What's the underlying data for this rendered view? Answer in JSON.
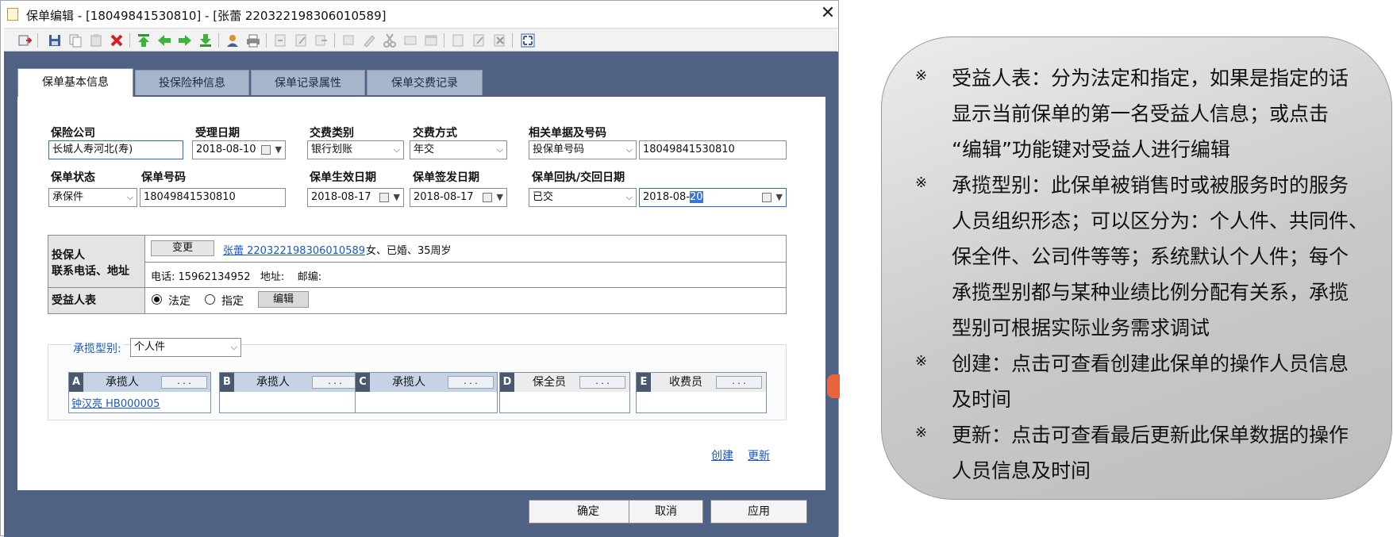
{
  "window": {
    "title": "保单编辑 - [18049841530810] - [张蕾 220322198306010589]",
    "close": "✕"
  },
  "toolbar": {
    "icons": [
      "exit-icon",
      "save-icon",
      "copy-icon",
      "paste-icon",
      "delete-icon",
      "first-icon",
      "prev-icon",
      "next-icon",
      "last-icon",
      "user-icon",
      "print-icon",
      "import-icon",
      "edit-icon",
      "export-icon",
      "review-icon",
      "pen-icon",
      "cut-icon",
      "approve-icon",
      "window-icon",
      "doc-icon",
      "modify-icon",
      "remove-icon",
      "fullscreen-icon"
    ]
  },
  "tabs": [
    "保单基本信息",
    "投保险种信息",
    "保单记录属性",
    "保单交费记录"
  ],
  "form": {
    "insurer_label": "保险公司",
    "insurer_value": "长城人寿河北(寿)",
    "accept_date_label": "受理日期",
    "accept_date_value": "2018-08-10",
    "pay_type_label": "交费类别",
    "pay_type_value": "银行划账",
    "pay_mode_label": "交费方式",
    "pay_mode_value": "年交",
    "related_doc_label": "相关单据及号码",
    "related_doc_type": "投保单号码",
    "related_doc_no": "18049841530810",
    "status_label": "保单状态",
    "status_value": "承保件",
    "policy_no_label": "保单号码",
    "policy_no_value": "18049841530810",
    "effective_label": "保单生效日期",
    "effective_value": "2018-08-17",
    "issue_label": "保单签发日期",
    "issue_value": "2018-08-17",
    "receipt_label": "保单回执/交回日期",
    "receipt_status": "已交",
    "receipt_date_pre": "2018-08-",
    "receipt_date_sel": "20"
  },
  "holder": {
    "label_line1": "投保人",
    "label_line2": "联系电话、地址",
    "change_button": "变更",
    "name_link": "张蕾 220322198306010589",
    "summary": "女、已婚、35周岁",
    "contact": "电话: 15962134952   地址:    邮编:",
    "beneficiary_label": "受益人表",
    "radio_legal": "法定",
    "radio_designated": "指定",
    "edit_button": "编辑"
  },
  "contract": {
    "type_label": "承揽型别:",
    "type_value": "个人件",
    "cards": [
      {
        "letter": "A",
        "name": "承揽人",
        "dots": ". . .",
        "value": "钟汉亮 HB000005"
      },
      {
        "letter": "B",
        "name": "承揽人",
        "dots": ". . .",
        "value": ""
      },
      {
        "letter": "C",
        "name": "承揽人",
        "dots": ". . .",
        "value": ""
      },
      {
        "letter": "D",
        "name": "保全员",
        "dots": ". . .",
        "value": ""
      },
      {
        "letter": "E",
        "name": "收费员",
        "dots": ". . .",
        "value": ""
      }
    ]
  },
  "links": {
    "create": "创建",
    "update": "更新"
  },
  "buttons": {
    "ok": "确定",
    "cancel": "取消",
    "apply": "应用"
  },
  "note": {
    "mark": "※",
    "lines": [
      "受益人表：分为法定和指定，如果是指定的话",
      "显示当前保单的第一名受益人信息；或点击",
      "“编辑”功能键对受益人进行编辑",
      "承揽型别：此保单被销售时或被服务时的服务",
      "人员组织形态；可以区分为：个人件、共同件、",
      "保全件、公司件等等；系统默认个人件；每个",
      "承揽型别都与某种业绩比例分配有关系，承揽",
      "型别可根据实际业务需求调试",
      "创建：点击可查看创建此保单的操作人员信息",
      "及时间",
      "更新：点击可查看最后更新此保单数据的操作",
      "人员信息及时间"
    ]
  }
}
